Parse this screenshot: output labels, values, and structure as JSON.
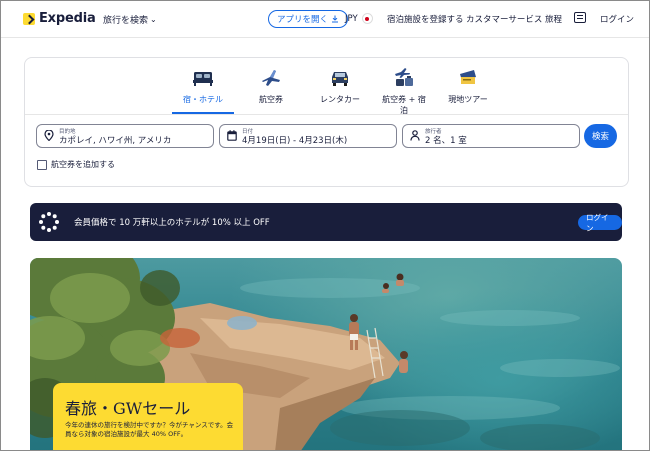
{
  "header": {
    "logo_text": "Expedia",
    "explore": "旅行を検索",
    "app_button": "アプリを開く",
    "currency": "JPY",
    "list_property": "宿泊施設を登録する",
    "customer_service": "カスタマーサービス",
    "trips": "旅程",
    "login": "ログイン"
  },
  "tabs": [
    {
      "label": "宿・ホテル",
      "icon": "bed-icon",
      "active": true
    },
    {
      "label": "航空券",
      "icon": "airplane-icon"
    },
    {
      "label": "レンタカー",
      "icon": "car-icon"
    },
    {
      "label": "航空券 + 宿泊",
      "icon": "package-icon"
    },
    {
      "label": "現地ツアー",
      "icon": "ticket-icon"
    }
  ],
  "search": {
    "destination_label": "目的地",
    "destination_value": "カポレイ, ハワイ州, アメリカ",
    "dates_label": "日付",
    "dates_value": "4月19日(日) - 4月23日(木)",
    "travelers_label": "旅行者",
    "travelers_value": "2 名、1 室",
    "search_button": "検索",
    "add_flight": "航空券を追加する"
  },
  "banner": {
    "text": "会員価格で 10 万軒以上のホテルが 10% 以上 OFF",
    "button": "ログイン"
  },
  "hero": {
    "sale_title": "春旅・GWセール",
    "sale_desc": "今年の連休の旅行を検討中ですか？今がチャンスです。会員なら対象の宿泊施設が最大 40% OFF。"
  },
  "colors": {
    "brand_blue": "#1668e3",
    "navy": "#191e3b",
    "yellow": "#fddb32"
  }
}
